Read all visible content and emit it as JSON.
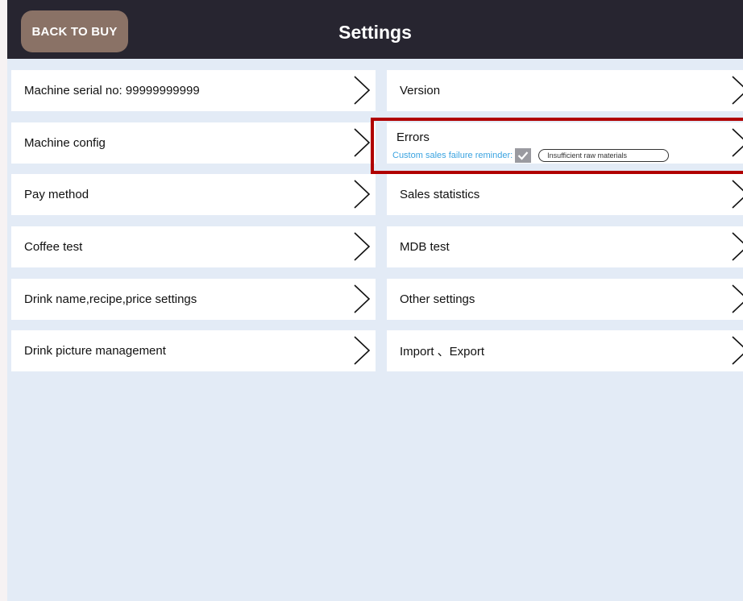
{
  "header": {
    "back_label": "BACK TO BUY",
    "title": "Settings"
  },
  "left_menu": [
    {
      "label": "Machine serial no: 99999999999"
    },
    {
      "label": "Machine config"
    },
    {
      "label": "Pay method"
    },
    {
      "label": "Coffee test"
    },
    {
      "label": "Drink name,recipe,price settings"
    },
    {
      "label": "Drink picture management"
    }
  ],
  "right_menu": [
    {
      "label": "Version"
    },
    {
      "label": "Errors"
    },
    {
      "label": "Sales statistics"
    },
    {
      "label": "MDB test"
    },
    {
      "label": "Other settings"
    },
    {
      "label": "Import 、Export"
    }
  ],
  "errors": {
    "reminder_label": "Custom sales failure reminder:",
    "reminder_checked": true,
    "reminder_value": "Insufficient raw materials"
  },
  "colors": {
    "topbar": "#272530",
    "back_button": "#8a7266",
    "background": "#e3ebf6",
    "reminder_text": "#3aa3e0",
    "highlight_box": "#b00000"
  },
  "icons": {
    "chevron": "chevron-right-icon",
    "check": "checkmark-icon"
  }
}
